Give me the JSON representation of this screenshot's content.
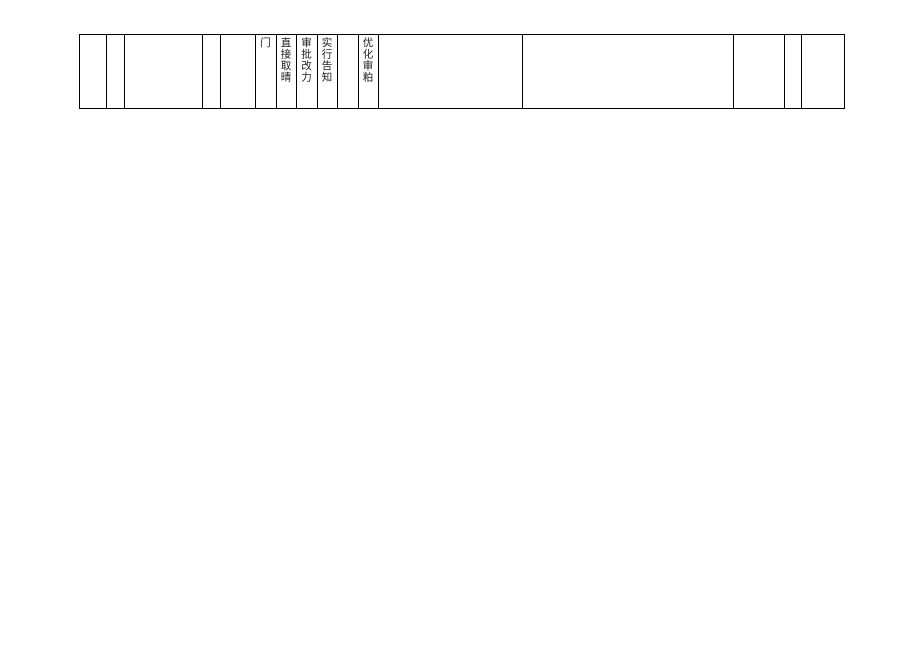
{
  "cells": {
    "col6": "门",
    "col7": "直接取晴",
    "col8": "审批改力",
    "col9": "实行告知",
    "col10": "",
    "col11": "优化审粕"
  }
}
